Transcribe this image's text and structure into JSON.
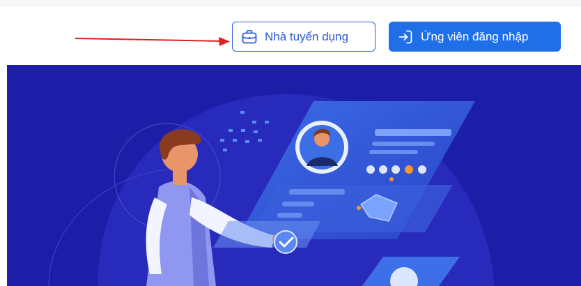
{
  "header": {
    "employer_button": {
      "label": "Nhà tuyển dụng",
      "icon": "briefcase-icon"
    },
    "login_button": {
      "label": "Ứng viên đăng nhập",
      "icon": "login-arrow-icon"
    }
  },
  "annotation": {
    "arrow_color": "#e02020"
  },
  "colors": {
    "primary": "#1f6fe8",
    "outline": "#2a5bd7",
    "hero_background": "#1c1ea8"
  }
}
